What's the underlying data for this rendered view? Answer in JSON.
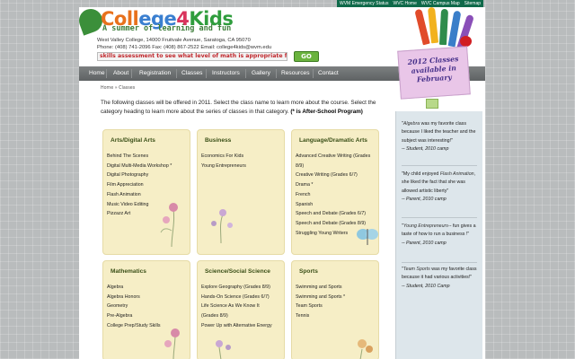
{
  "topbar": {
    "links": [
      "WVM Emergency Status",
      "WVC Home",
      "WVC Campus Map",
      "Sitemap"
    ]
  },
  "header": {
    "logo_parts": [
      "Coll",
      "ege",
      "4",
      "Kids"
    ],
    "tagline": "A summer of learning and fun",
    "address_line1": "West Valley College, 14000 Fruitvale Avenue, Saratoga, CA 95070",
    "address_line2": "Phone: (408) 741-2096 Fax: (408) 867-2522 Email: college4kids@wvm.edu",
    "assessment_text": "skills assessment to see what level of math is appropriate for you",
    "go_label": "GO"
  },
  "nav": {
    "items": [
      "Home",
      "About",
      "Registration",
      "Classes",
      "Instructors",
      "Gallery",
      "Resources",
      "Contact"
    ]
  },
  "breadcrumb": "Home » Classes",
  "intro": {
    "text": "The following classes will be offered in 2011. Select the class name to learn more about the course. Select the category heading to learn more about the series of classes in that category.",
    "note": "(* is After-School Program)"
  },
  "categories": [
    {
      "title": "Arts/Digital Arts",
      "classes": [
        "Behind The Scenes",
        "Digital Multi-Media Workshop *",
        "Digital Photography",
        "Film Appreciation",
        "Flash Animation",
        "Music Video Editing",
        "Pizzazz Art"
      ]
    },
    {
      "title": "Business",
      "classes": [
        "Economics For Kids",
        "Young Entrepreneurs"
      ]
    },
    {
      "title": "Language/Dramatic Arts",
      "classes": [
        "Advanced Creative Writing (Grades 8/9)",
        "Creative Writing (Grades 6/7)",
        "Drama *",
        "French",
        "Spanish",
        "Speech and Debate (Grades 6/7)",
        "Speech and Debate (Grades 8/9)",
        "Struggling Young Writers"
      ]
    },
    {
      "title": "Mathematics",
      "classes": [
        "Algebra",
        "Algebra Honors",
        "Geometry",
        "Pre-Algebra",
        "College Prep/Study Skills"
      ]
    },
    {
      "title": "Science/Social Science",
      "classes": [
        "Explore Geography (Grades 8/9)",
        "Hands-On Science (Grades 6/7)",
        "Life Science As We Know It (Grades 8/9)",
        "Power Up with Alternative Energy"
      ]
    },
    {
      "title": "Sports",
      "classes": [
        "Swimming and Sports",
        "Swimming and Sports *",
        "Team Sports",
        "Tennis"
      ]
    }
  ],
  "sticky_note": {
    "line1": "2012 Classes",
    "line2": "available in",
    "line3": "February"
  },
  "testimonials": [
    {
      "before": "\"",
      "italic": "Algebra",
      "after": " was my favorite class because I liked the teacher and the subject was interesting!\"",
      "author": "-- Student, 2010 camp"
    },
    {
      "before": "\"My child enjoyed ",
      "italic": "Flash Animation",
      "after": ", she liked the fact that she was allowed artistic liberty\"",
      "author": "-- Parent, 2010 camp"
    },
    {
      "before": "\"",
      "italic": "Young Entrepreneurs",
      "after": "-- fun gives a taste of how to run a business !\"",
      "author": "-- Parent, 2010 camp"
    },
    {
      "before": "\"",
      "italic": "Team Sports",
      "after": " was my favorite class because it had various activities!\"",
      "author": "-- Student, 2010 Camp"
    }
  ],
  "colors": {
    "topbar": "#0f6a4a",
    "nav": "#6d7071",
    "card_bg": "#f6eec6",
    "card_title": "#3a4f17",
    "sticky_note": "#e9c6e8",
    "assessment_text": "#c0282d",
    "go_button": "#6ab33e"
  }
}
